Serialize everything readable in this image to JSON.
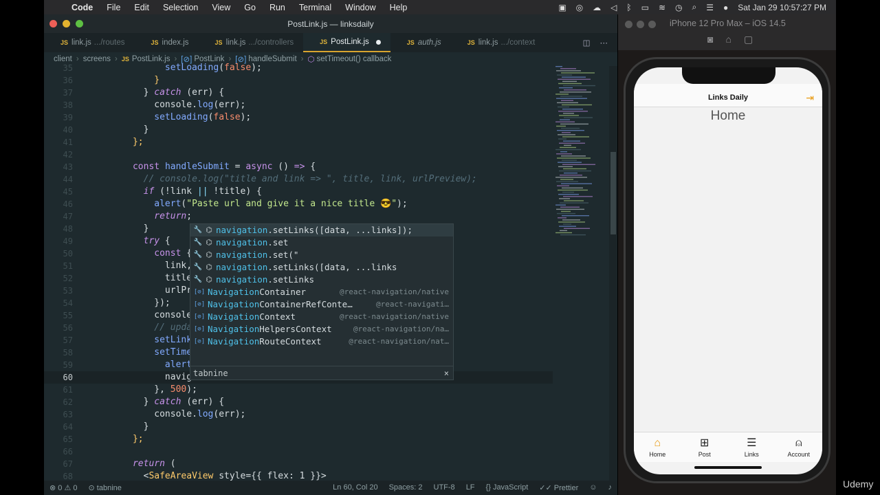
{
  "menubar": {
    "app": "Code",
    "items": [
      "File",
      "Edit",
      "Selection",
      "View",
      "Go",
      "Run",
      "Terminal",
      "Window",
      "Help"
    ],
    "clock": "Sat Jan 29  10:57:27 PM"
  },
  "window": {
    "title": "PostLink.js — linksdaily"
  },
  "tabs": [
    {
      "name": "link.js",
      "path": ".../routes"
    },
    {
      "name": "index.js",
      "path": ""
    },
    {
      "name": "link.js",
      "path": ".../controllers"
    },
    {
      "name": "PostLink.js",
      "path": ""
    },
    {
      "name": "auth.js",
      "path": ""
    },
    {
      "name": "link.js",
      "path": ".../context"
    }
  ],
  "breadcrumb": [
    "client",
    "screens",
    "PostLink.js",
    "PostLink",
    "handleSubmit",
    "setTimeout() callback"
  ],
  "lines": [
    {
      "n": "35",
      "indent": "            ",
      "tokens": [
        [
          "f",
          "setLoading"
        ],
        [
          "w",
          "("
        ],
        [
          "b",
          "false"
        ],
        [
          "w",
          ");"
        ]
      ]
    },
    {
      "n": "36",
      "indent": "          ",
      "tokens": [
        [
          "y",
          "}"
        ]
      ]
    },
    {
      "n": "37",
      "indent": "        ",
      "tokens": [
        [
          "w",
          "} "
        ],
        [
          "k",
          "catch"
        ],
        [
          "w",
          " (err) {"
        ]
      ]
    },
    {
      "n": "38",
      "indent": "          ",
      "tokens": [
        [
          "w",
          "console."
        ],
        [
          "f",
          "log"
        ],
        [
          "w",
          "(err);"
        ]
      ]
    },
    {
      "n": "39",
      "indent": "          ",
      "tokens": [
        [
          "f",
          "setLoading"
        ],
        [
          "w",
          "("
        ],
        [
          "b",
          "false"
        ],
        [
          "w",
          ");"
        ]
      ]
    },
    {
      "n": "40",
      "indent": "        ",
      "tokens": [
        [
          "w",
          "}"
        ]
      ]
    },
    {
      "n": "41",
      "indent": "      ",
      "tokens": [
        [
          "y",
          "};"
        ]
      ]
    },
    {
      "n": "42",
      "indent": "",
      "tokens": []
    },
    {
      "n": "43",
      "indent": "      ",
      "tokens": [
        [
          "kw",
          "const "
        ],
        [
          "f",
          "handleSubmit"
        ],
        [
          "w",
          " = "
        ],
        [
          "kw",
          "async"
        ],
        [
          "w",
          " () "
        ],
        [
          "kw",
          "=>"
        ],
        [
          "w",
          " {"
        ]
      ]
    },
    {
      "n": "44",
      "indent": "        ",
      "tokens": [
        [
          "c",
          "// console.log(\"title and link => \", title, link, urlPreview);"
        ]
      ]
    },
    {
      "n": "45",
      "indent": "        ",
      "tokens": [
        [
          "k",
          "if"
        ],
        [
          "w",
          " (!link "
        ],
        [
          "p",
          "||"
        ],
        [
          "w",
          " !title) {"
        ]
      ]
    },
    {
      "n": "46",
      "indent": "          ",
      "tokens": [
        [
          "f",
          "alert"
        ],
        [
          "w",
          "("
        ],
        [
          "s",
          "\"Paste url and give it a nice title 😎\""
        ],
        [
          "w",
          ");"
        ]
      ]
    },
    {
      "n": "47",
      "indent": "          ",
      "tokens": [
        [
          "k",
          "return"
        ],
        [
          "w",
          ";"
        ]
      ]
    },
    {
      "n": "48",
      "indent": "        ",
      "tokens": [
        [
          "w",
          "}"
        ]
      ]
    },
    {
      "n": "49",
      "indent": "        ",
      "tokens": [
        [
          "k",
          "try"
        ],
        [
          "w",
          " {"
        ]
      ]
    },
    {
      "n": "50",
      "indent": "          ",
      "tokens": [
        [
          "kw",
          "const"
        ],
        [
          "w",
          " { data"
        ]
      ]
    },
    {
      "n": "51",
      "indent": "            ",
      "tokens": [
        [
          "w",
          "link,"
        ]
      ]
    },
    {
      "n": "52",
      "indent": "            ",
      "tokens": [
        [
          "w",
          "title,"
        ]
      ]
    },
    {
      "n": "53",
      "indent": "            ",
      "tokens": [
        [
          "w",
          "urlPreview"
        ]
      ]
    },
    {
      "n": "54",
      "indent": "          ",
      "tokens": [
        [
          "w",
          "});"
        ]
      ]
    },
    {
      "n": "55",
      "indent": "          ",
      "tokens": [
        [
          "w",
          "console."
        ],
        [
          "f",
          "log"
        ],
        [
          "w",
          "("
        ]
      ]
    },
    {
      "n": "56",
      "indent": "          ",
      "tokens": [
        [
          "c",
          "// update li"
        ]
      ]
    },
    {
      "n": "57",
      "indent": "          ",
      "tokens": [
        [
          "f",
          "setLinks"
        ],
        [
          "w",
          "([da"
        ]
      ]
    },
    {
      "n": "58",
      "indent": "          ",
      "tokens": [
        [
          "f",
          "setTimeout"
        ],
        [
          "w",
          "(("
        ]
      ]
    },
    {
      "n": "59",
      "indent": "            ",
      "tokens": [
        [
          "f",
          "alert"
        ],
        [
          "w",
          "("
        ],
        [
          "s",
          "\"🎀 !"
        ]
      ]
    },
    {
      "n": "60",
      "indent": "            ",
      "tokens": [
        [
          "w",
          "navigation."
        ]
      ]
    },
    {
      "n": "61",
      "indent": "          ",
      "tokens": [
        [
          "w",
          "}, "
        ],
        [
          "b",
          "500"
        ],
        [
          "w",
          ");"
        ]
      ]
    },
    {
      "n": "62",
      "indent": "        ",
      "tokens": [
        [
          "w",
          "} "
        ],
        [
          "k",
          "catch"
        ],
        [
          "w",
          " (err) {"
        ]
      ]
    },
    {
      "n": "63",
      "indent": "          ",
      "tokens": [
        [
          "w",
          "console."
        ],
        [
          "f",
          "log"
        ],
        [
          "w",
          "(err);"
        ]
      ]
    },
    {
      "n": "64",
      "indent": "        ",
      "tokens": [
        [
          "w",
          "}"
        ]
      ]
    },
    {
      "n": "65",
      "indent": "      ",
      "tokens": [
        [
          "y",
          "};"
        ]
      ]
    },
    {
      "n": "66",
      "indent": "",
      "tokens": []
    },
    {
      "n": "67",
      "indent": "      ",
      "tokens": [
        [
          "k",
          "return"
        ],
        [
          "w",
          " ("
        ]
      ]
    },
    {
      "n": "68",
      "indent": "        ",
      "tokens": [
        [
          "w",
          "<"
        ],
        [
          "y",
          "SafeAreaView"
        ],
        [
          "w",
          " style={{ flex: 1 }}>"
        ]
      ]
    }
  ],
  "current_line": "60",
  "suggestions": [
    {
      "kind": "tabnine",
      "match": "navigation",
      "rest": ".setLinks([data, ...links]);",
      "source": ""
    },
    {
      "kind": "tabnine",
      "match": "navigation",
      "rest": ".set",
      "source": ""
    },
    {
      "kind": "tabnine",
      "match": "navigation",
      "rest": ".set(\"",
      "source": ""
    },
    {
      "kind": "tabnine",
      "match": "navigation",
      "rest": ".setLinks([data, ...links",
      "source": ""
    },
    {
      "kind": "tabnine",
      "match": "navigation",
      "rest": ".setLinks",
      "source": ""
    },
    {
      "kind": "module",
      "match": "Navigation",
      "rest": "Container",
      "source": "@react-navigation/native"
    },
    {
      "kind": "module",
      "match": "Navigation",
      "rest": "ContainerRefConte…",
      "source": "@react-navigati…"
    },
    {
      "kind": "module",
      "match": "Navigation",
      "rest": "Context",
      "source": "@react-navigation/native"
    },
    {
      "kind": "module",
      "match": "Navigation",
      "rest": "HelpersContext",
      "source": "@react-navigation/na…"
    },
    {
      "kind": "module",
      "match": "Navigation",
      "rest": "RouteContext",
      "source": "@react-navigation/nat…"
    }
  ],
  "suggest_footer": "tabnine",
  "statusbar": {
    "errors": "0",
    "warnings": "0",
    "tabnine": "tabnine",
    "position": "Ln 60, Col 20",
    "spaces": "Spaces: 2",
    "encoding": "UTF-8",
    "eol": "LF",
    "language": "JavaScript",
    "prettier": "Prettier"
  },
  "simulator": {
    "title": "iPhone 12 Pro Max – iOS 14.5",
    "app_title": "Links Daily",
    "screen_heading": "Home",
    "tabs": [
      {
        "label": "Home",
        "icon": "⌂"
      },
      {
        "label": "Post",
        "icon": "⊞"
      },
      {
        "label": "Links",
        "icon": "☰"
      },
      {
        "label": "Account",
        "icon": "⍝"
      }
    ]
  },
  "watermark": "Udemy"
}
